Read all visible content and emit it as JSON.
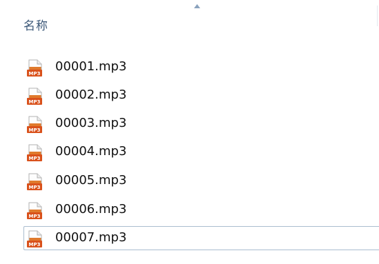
{
  "header": {
    "name_column": "名称"
  },
  "icons": {
    "file_icon": "mp3-file-icon",
    "file_icon_label": "MP3",
    "sort_indicator": "sort-ascending-icon"
  },
  "colors": {
    "icon_base": "#e07a2c",
    "icon_badge": "#d9511b",
    "selection_border": "#a9bccf",
    "header_text": "#3c5878"
  },
  "files": [
    {
      "name": "00001.mp3",
      "selected": false
    },
    {
      "name": "00002.mp3",
      "selected": false
    },
    {
      "name": "00003.mp3",
      "selected": false
    },
    {
      "name": "00004.mp3",
      "selected": false
    },
    {
      "name": "00005.mp3",
      "selected": false
    },
    {
      "name": "00006.mp3",
      "selected": false
    },
    {
      "name": "00007.mp3",
      "selected": true
    }
  ]
}
